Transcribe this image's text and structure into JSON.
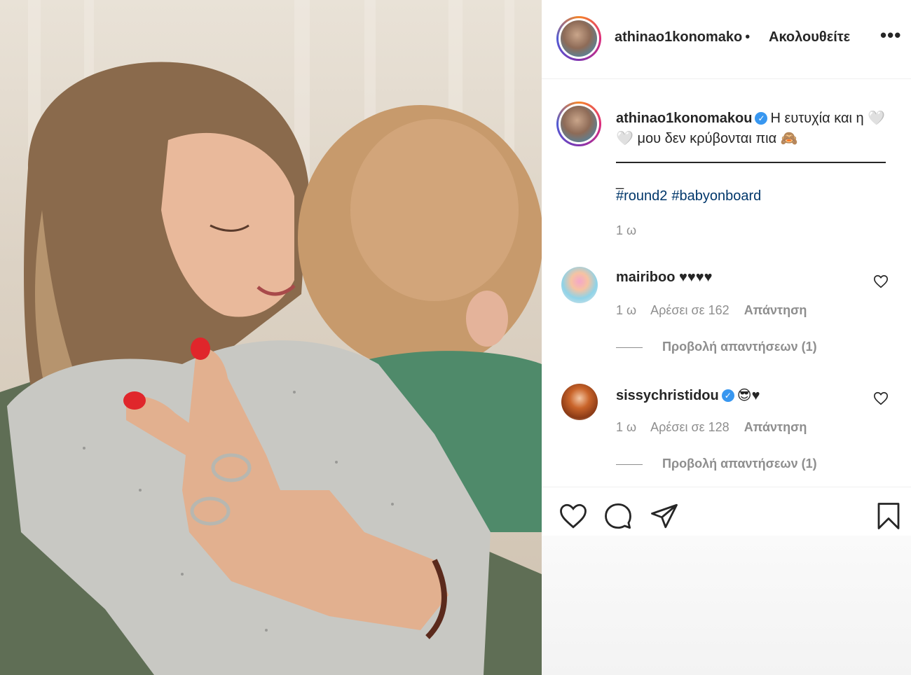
{
  "header": {
    "username": "athinao1konomako",
    "separator": "•",
    "follow_label": "Ακολουθείτε",
    "more_icon": "ellipsis-icon"
  },
  "caption": {
    "username": "athinao1konomakou",
    "text": "Η ευτυχία και η 🤍🤍 μου δεν κρύβονται πια 🙈",
    "dash_tail": "_",
    "hashtags": [
      "#round2",
      "#babyonboard"
    ],
    "time": "1 ω"
  },
  "comments": [
    {
      "username": "mairiboo",
      "text": "♥♥♥♥",
      "time": "1 ω",
      "likes": "Αρέσει σε 162",
      "reply_label": "Απάντηση",
      "view_replies": "Προβολή απαντήσεων (1)",
      "verified": false
    },
    {
      "username": "sissychristidou",
      "text": "😎♥",
      "time": "1 ω",
      "likes": "Αρέσει σε 128",
      "reply_label": "Απάντηση",
      "view_replies": "Προβολή απαντήσεων (1)",
      "verified": true
    }
  ],
  "actions": [
    "heart-icon",
    "comment-icon",
    "share-icon",
    "bookmark-icon"
  ],
  "colors": {
    "link": "#00376b",
    "verified": "#3897f0",
    "muted": "#8e8e8e",
    "nail": "#e0262b",
    "sweater": "#5f6e55"
  }
}
